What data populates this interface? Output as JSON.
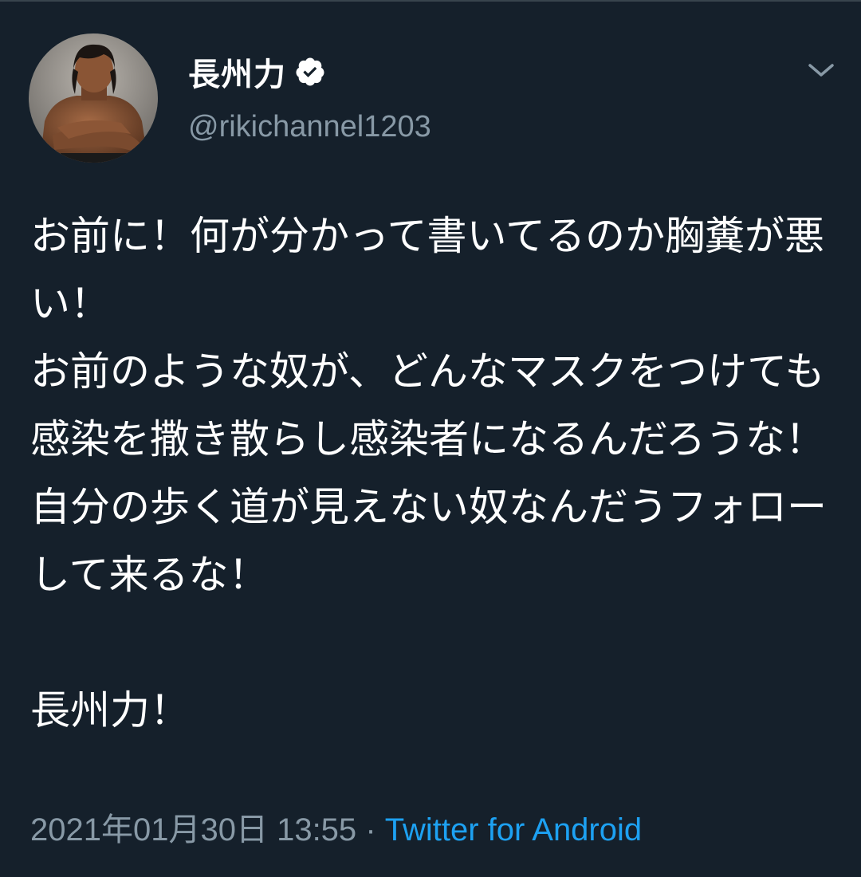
{
  "tweet": {
    "author": {
      "display_name": "長州力",
      "handle": "@rikichannel1203",
      "verified": true,
      "avatar_icon": "wrestler-avatar"
    },
    "text": "お前に！何が分かって書いてるのか胸糞が悪い！\nお前のような奴が、どんなマスクをつけても感染を撒き散らし感染者になるんだろうな！\n自分の歩く道が見えない奴なんだうフォロー して来るな！\n\n長州力！",
    "timestamp": "2021年01月30日 13:55",
    "separator": "·",
    "source": "Twitter for Android"
  },
  "icons": {
    "verified": "verified-badge-icon",
    "more": "chevron-down-icon"
  },
  "colors": {
    "background": "#15202b",
    "text": "#ffffff",
    "secondary": "#8899a6",
    "link": "#1da1f2"
  }
}
